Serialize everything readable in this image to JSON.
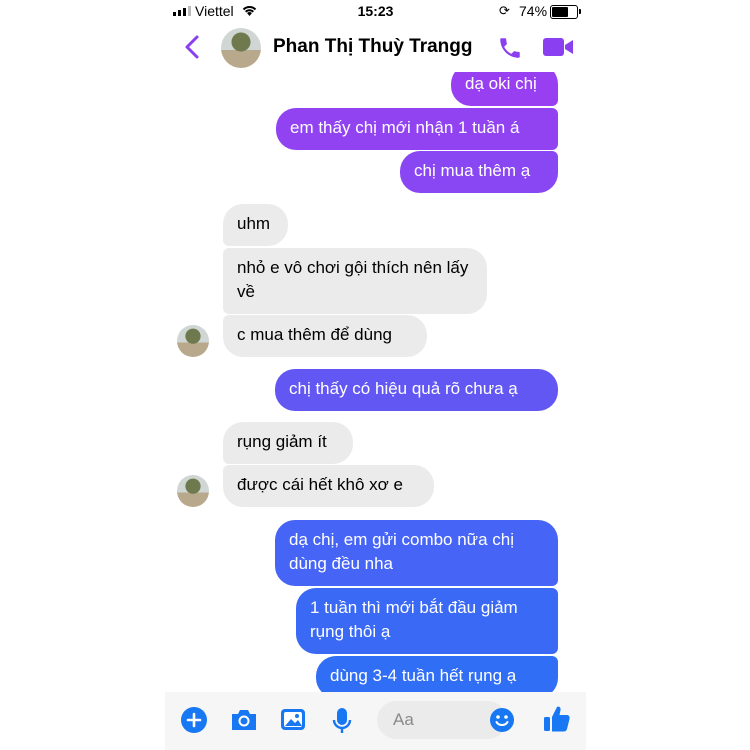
{
  "status_bar": {
    "carrier": "Viettel",
    "time": "15:23",
    "battery_percent": "74%",
    "battery_level": 0.74
  },
  "header": {
    "contact_name": "Phan Thị Thuỳ Trangg",
    "icons": [
      "chevron-left-icon",
      "phone-call-icon",
      "video-call-icon"
    ]
  },
  "colors": {
    "accent": "#8a3ff0",
    "bubble_out_top": "#9b3ef2",
    "bubble_out_bottom": "#2d6ff6",
    "bubble_in": "#ebebeb"
  },
  "messages": [
    {
      "sender": "me",
      "text": "dạ oki chị"
    },
    {
      "sender": "me",
      "text": "em thấy chị mới nhận 1 tuần á"
    },
    {
      "sender": "me",
      "text": "chị mua thêm ạ"
    },
    {
      "sender": "them",
      "text": "uhm"
    },
    {
      "sender": "them",
      "text": "nhỏ e vô chơi gội thích nên lấy về"
    },
    {
      "sender": "them",
      "text": "c mua thêm để dùng"
    },
    {
      "sender": "me",
      "text": "chị thấy có hiệu quả rõ chưa ạ"
    },
    {
      "sender": "them",
      "text": "rụng giảm ít"
    },
    {
      "sender": "them",
      "text": "được cái hết khô xơ e"
    },
    {
      "sender": "me",
      "text": "dạ chị, em gửi combo nữa chị dùng đều nha"
    },
    {
      "sender": "me",
      "text": "1 tuần thì mới bắt đầu giảm rụng thôi ạ"
    },
    {
      "sender": "me",
      "text": "dùng 3-4 tuần hết rụng ạ"
    }
  ],
  "composer": {
    "placeholder": "Aa",
    "icons": [
      "plus-circle-icon",
      "camera-icon",
      "image-icon",
      "microphone-icon",
      "emoji-icon",
      "thumbs-up-icon"
    ]
  }
}
